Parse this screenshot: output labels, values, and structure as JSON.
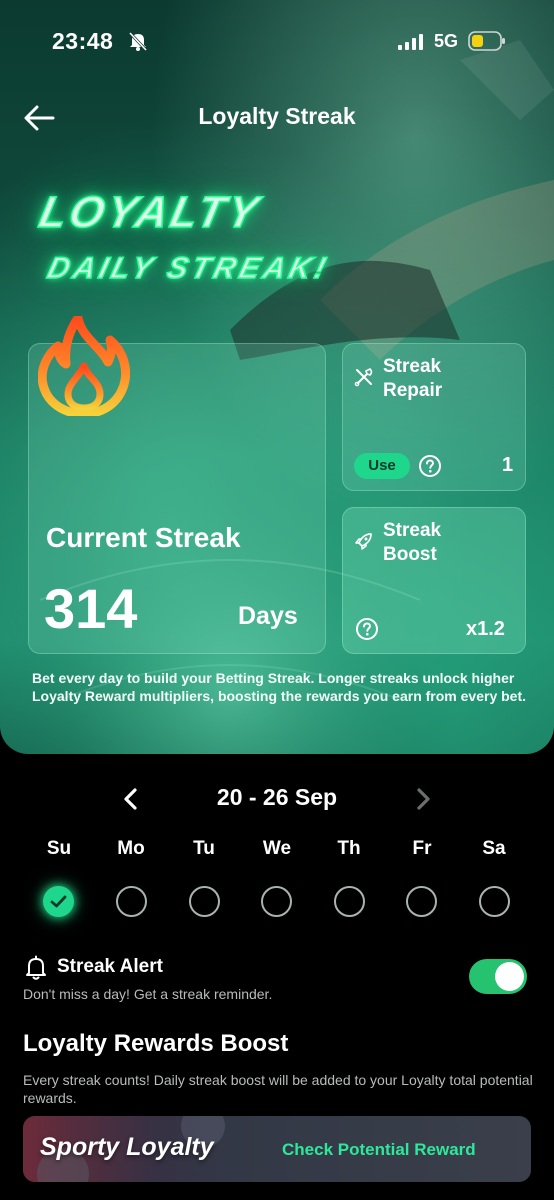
{
  "status_bar": {
    "time": "23:48",
    "network": "5G"
  },
  "header": {
    "title": "Loyalty Streak"
  },
  "banner": {
    "line1": "Loyalty",
    "line2": "Daily Streak!"
  },
  "current_streak": {
    "label": "Current Streak",
    "value": "314",
    "unit": "Days"
  },
  "streak_repair": {
    "title_line1": "Streak",
    "title_line2": "Repair",
    "use_label": "Use",
    "count": "1"
  },
  "streak_boost": {
    "title_line1": "Streak",
    "title_line2": "Boost",
    "multiplier": "x1.2"
  },
  "hero_description": "Bet every day to build your Betting Streak. Longer streaks unlock higher Loyalty Reward multipliers, boosting the rewards you earn from every bet.",
  "calendar": {
    "range": "20 - 26 Sep",
    "days": [
      {
        "label": "Su",
        "done": true
      },
      {
        "label": "Mo",
        "done": false
      },
      {
        "label": "Tu",
        "done": false
      },
      {
        "label": "We",
        "done": false
      },
      {
        "label": "Th",
        "done": false
      },
      {
        "label": "Fr",
        "done": false
      },
      {
        "label": "Sa",
        "done": false
      }
    ]
  },
  "streak_alert": {
    "title": "Streak Alert",
    "subtitle": "Don't miss a day! Get a streak reminder.",
    "enabled": true
  },
  "rewards_boost": {
    "heading": "Loyalty Rewards Boost",
    "description": "Every streak counts! Daily streak boost will be added to your Loyalty total potential rewards."
  },
  "promo": {
    "brand": "Sporty Loyalty",
    "cta": "Check Potential Reward"
  },
  "colors": {
    "accent": "#1ed68c",
    "toggle_on": "#25c36f",
    "background": "#000000"
  }
}
